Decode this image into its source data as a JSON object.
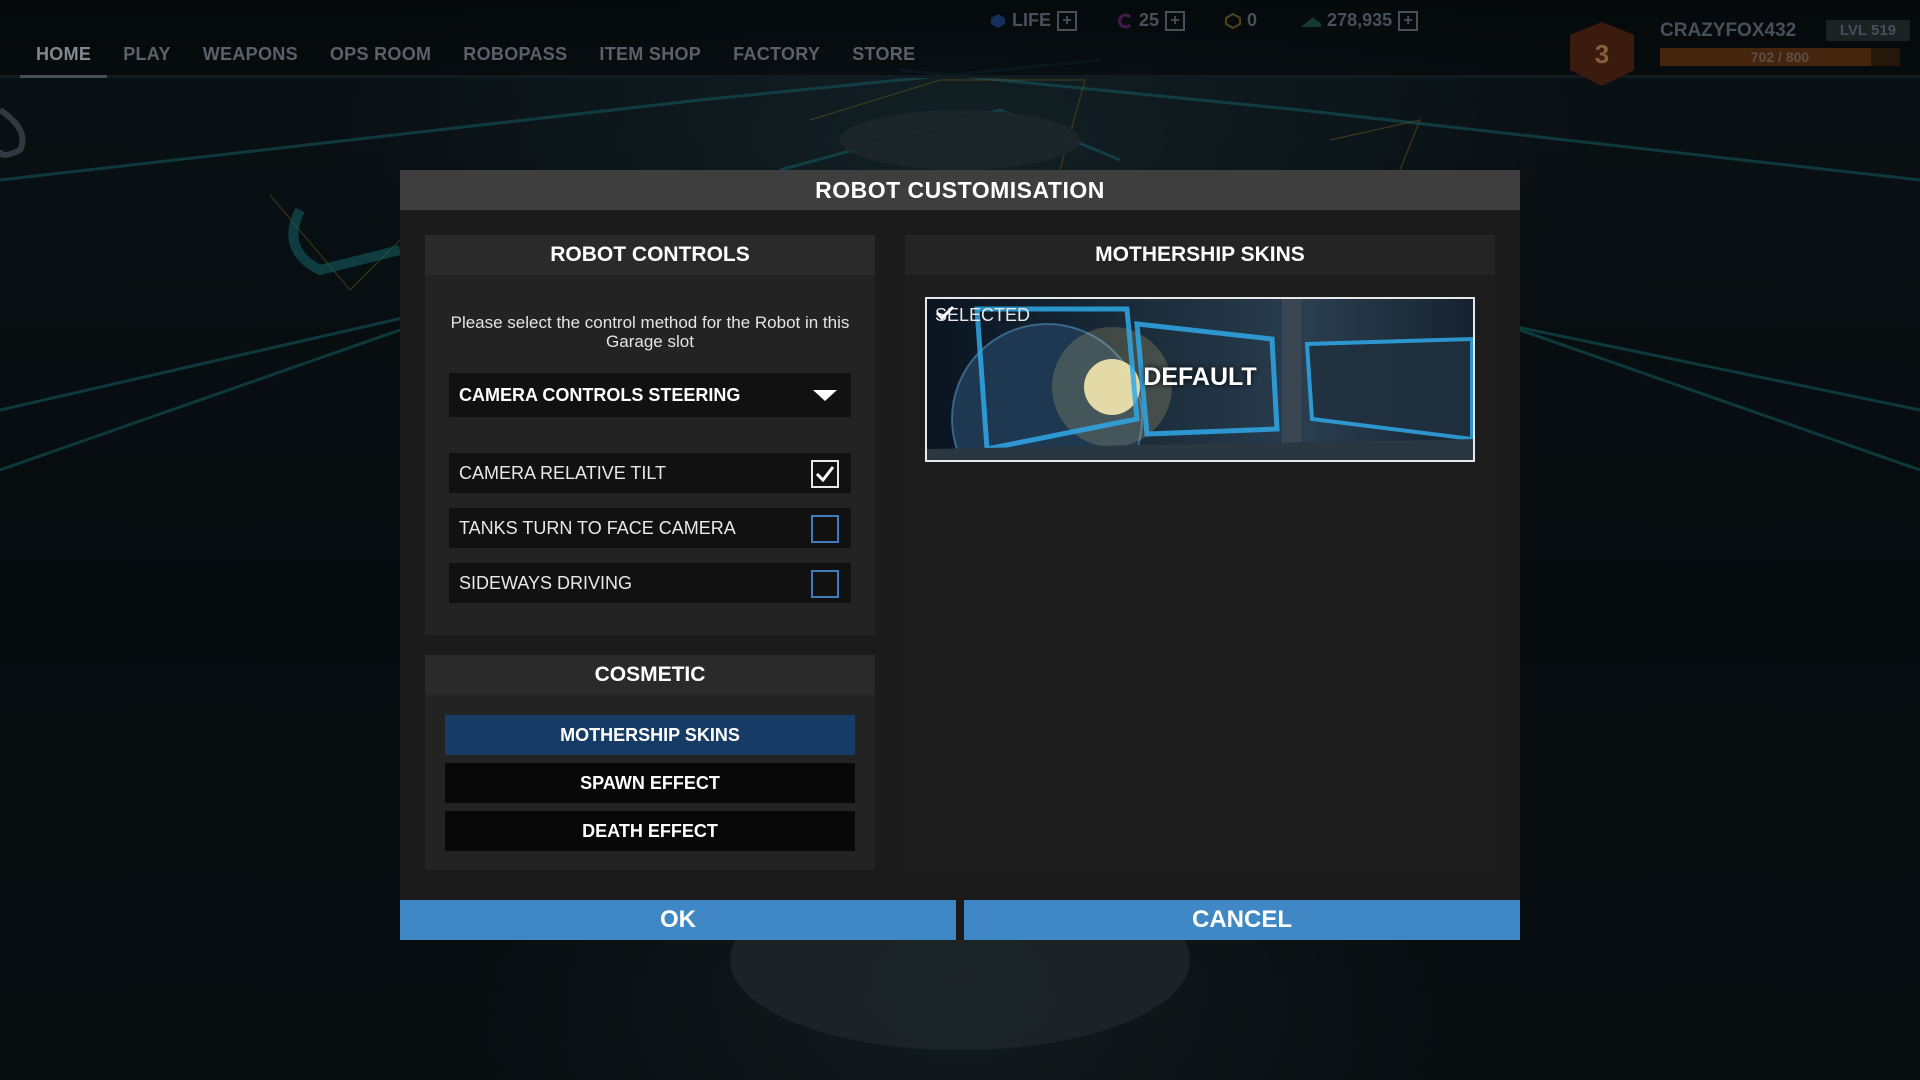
{
  "nav": {
    "tabs": [
      "HOME",
      "PLAY",
      "WEAPONS",
      "OPS ROOM",
      "ROBOPASS",
      "ITEM SHOP",
      "FACTORY",
      "STORE"
    ],
    "active_tab": "HOME"
  },
  "currencies": {
    "life": "LIFE",
    "cosmetic_credits": "25",
    "robits_alt": "0",
    "robits": "278,935"
  },
  "profile": {
    "rank": "3",
    "username": "CRAZYFOX432",
    "level": "LVL 519",
    "xp_text": "702 / 800",
    "xp_fraction": 0.8775
  },
  "modal": {
    "title": "ROBOT CUSTOMISATION",
    "controls": {
      "heading": "ROBOT CONTROLS",
      "description": "Please select the control method for the Robot in this Garage slot",
      "dropdown_value": "CAMERA CONTROLS STEERING",
      "options": [
        {
          "label": "CAMERA RELATIVE TILT",
          "checked": true
        },
        {
          "label": "TANKS TURN TO FACE CAMERA",
          "checked": false
        },
        {
          "label": "SIDEWAYS DRIVING",
          "checked": false
        }
      ]
    },
    "cosmetic": {
      "heading": "COSMETIC",
      "buttons": [
        "MOTHERSHIP SKINS",
        "SPAWN EFFECT",
        "DEATH EFFECT"
      ],
      "active": "MOTHERSHIP SKINS"
    },
    "skins": {
      "heading": "MOTHERSHIP SKINS",
      "selected_label": "SELECTED",
      "skin_name": "DEFAULT"
    },
    "ok_label": "OK",
    "cancel_label": "CANCEL"
  },
  "colors": {
    "accent_blue": "#3f88c5",
    "active_tab_bg": "#163b64",
    "checkbox_border": "#3f7bbd"
  }
}
